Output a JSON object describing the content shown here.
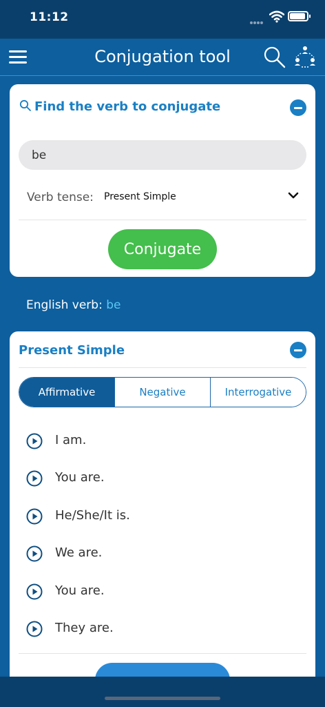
{
  "status_bar": {
    "time": "11:12"
  },
  "header": {
    "title": "Conjugation tool",
    "menu_icon": "hamburger-menu-icon",
    "search_icon": "search-icon",
    "network_icon": "network-icon"
  },
  "search_card": {
    "heading": "Find the verb to conjugate",
    "input_value": "be",
    "tense_label": "Verb tense:",
    "tense_value": "Present Simple",
    "button_label": "Conjugate"
  },
  "verb_info": {
    "label": "English verb:",
    "verb": "be"
  },
  "results": {
    "title": "Present Simple",
    "tabs": [
      {
        "label": "Affirmative",
        "active": true
      },
      {
        "label": "Negative",
        "active": false
      },
      {
        "label": "Interrogative",
        "active": false
      }
    ],
    "conjugations": [
      "I am.",
      "You are.",
      "He/She/It is.",
      "We are.",
      "You are.",
      "They are."
    ]
  },
  "colors": {
    "background": "#0d5f9e",
    "status_bar": "#0b3f6b",
    "accent": "#1a7fc4",
    "button_green": "#44be4c",
    "verb_link": "#5cc7f5"
  }
}
